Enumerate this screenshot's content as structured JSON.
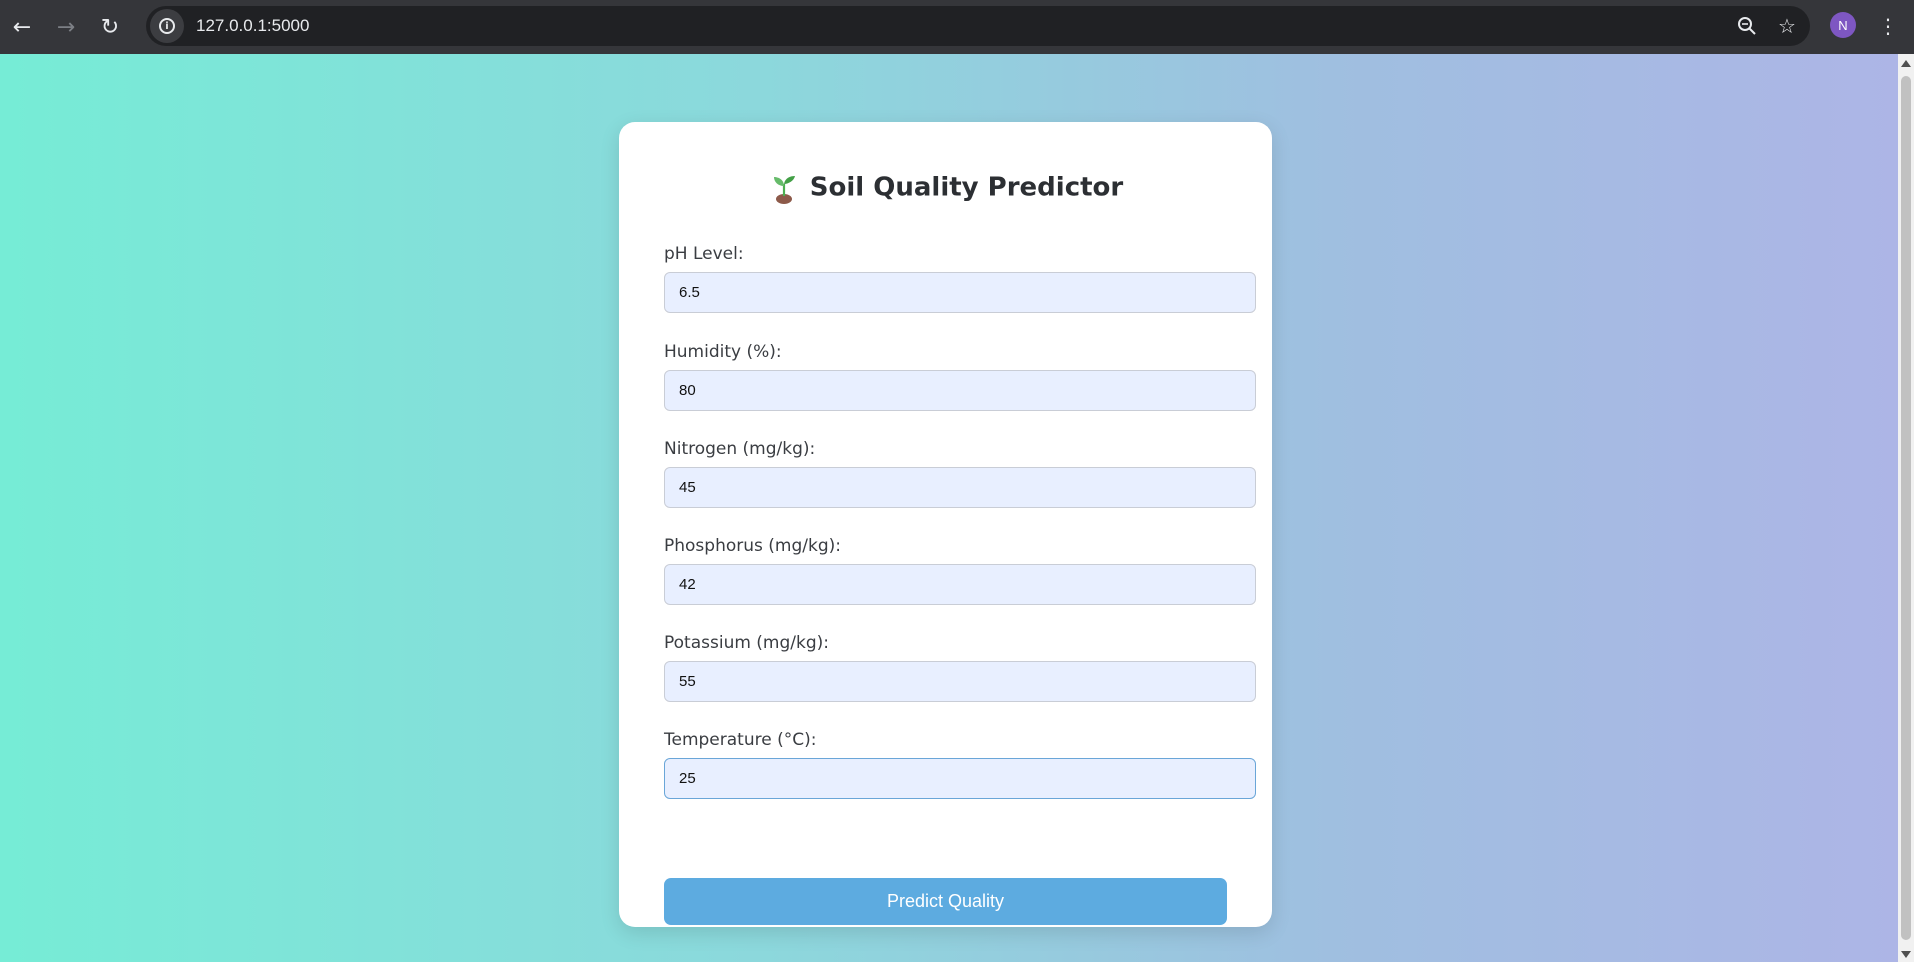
{
  "browser": {
    "url": "127.0.0.1:5000",
    "profile_initial": "N",
    "icons": {
      "back": "arrow-left-icon",
      "forward": "arrow-right-icon",
      "reload": "reload-icon",
      "site_info": "info-icon",
      "zoom": "zoom-icon",
      "bookmark": "star-icon",
      "menu": "kebab-menu-icon"
    }
  },
  "page": {
    "title": "Soil Quality Predictor",
    "title_icon": "seedling-icon",
    "fields": [
      {
        "label": "pH Level:",
        "value": "6.5"
      },
      {
        "label": "Humidity (%):",
        "value": "80"
      },
      {
        "label": "Nitrogen (mg/kg):",
        "value": "45"
      },
      {
        "label": "Phosphorus (mg/kg):",
        "value": "42"
      },
      {
        "label": "Potassium (mg/kg):",
        "value": "55"
      },
      {
        "label": "Temperature (°C):",
        "value": "25"
      }
    ],
    "submit_label": "Predict Quality"
  },
  "colors": {
    "gradient_start": "#76ecd6",
    "gradient_end": "#adb5e6",
    "button": "#5dabe0",
    "input_bg": "#e8efff"
  }
}
